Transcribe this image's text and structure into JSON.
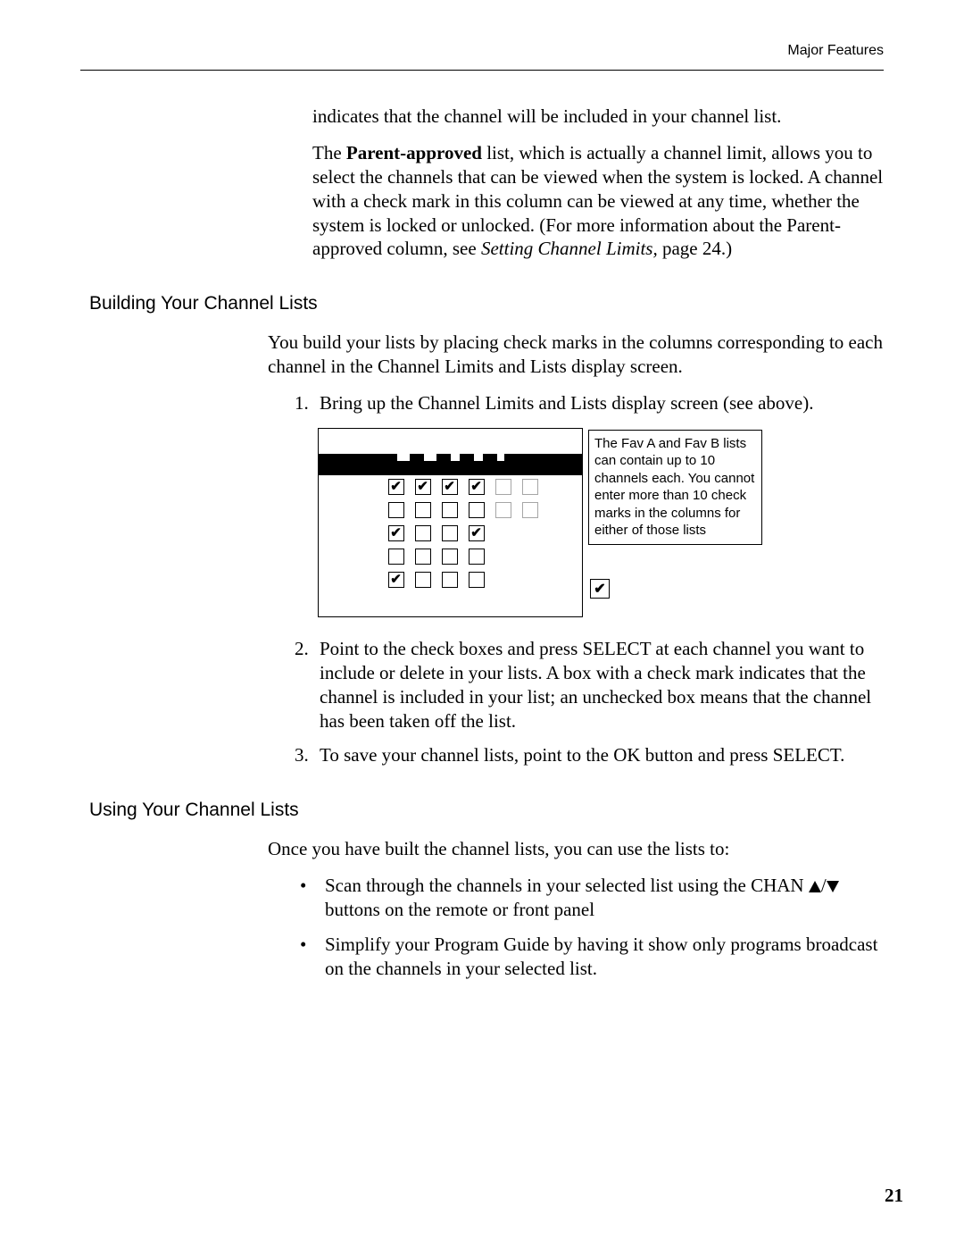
{
  "running_head": "Major Features",
  "intro_p1": "indicates that the channel will be included in your channel list.",
  "intro_p2_pre": "The ",
  "intro_p2_bold": "Parent-approved",
  "intro_p2_mid": " list, which is actually a channel limit, allows you to select the channels that can be viewed when the system is locked. A channel with a check mark in this column can be viewed at any time, whether the system is locked or unlocked. (For more information about the Parent-approved column, see ",
  "intro_p2_italic": "Setting Channel Limits,",
  "intro_p2_post": " page 24.)",
  "subhead1": "Building Your Channel Lists",
  "build_intro": "You build your lists by placing check marks in the columns corresponding to each channel in the Channel Limits and Lists display screen.",
  "ol1_num": "1.",
  "ol1_text": "Bring up the Channel Limits and Lists display screen (see above).",
  "callout_text": "The Fav A and Fav B lists can contain up to 10 channels each. You cannot enter more than 10 check marks in the columns for either of those lists",
  "ol2_num": "2.",
  "ol2_text": "Point to the check boxes and press SELECT at each channel you want to include or delete in your lists. A box with a check mark indicates that the channel is included in your list; an unchecked box means that the channel has been taken off the list.",
  "ol3_num": "3.",
  "ol3_text": "To save your channel lists, point to the OK button and press SELECT.",
  "subhead2": "Using Your Channel Lists",
  "use_intro": "Once you have built the channel lists, you can use the lists to:",
  "bullet1_pre": "Scan through the channels in your selected list using the CHAN ",
  "bullet1_sep": "/",
  "bullet1_post": " buttons on the remote or front panel",
  "bullet2": "Simplify your Program Guide by having it show only programs broadcast on the channels in your selected list.",
  "bullet_glyph": "•",
  "page_number": "21",
  "figure": {
    "rows": [
      [
        true,
        true,
        true,
        true,
        "pale",
        "pale"
      ],
      [
        false,
        false,
        false,
        false,
        "pale",
        "pale"
      ],
      [
        true,
        false,
        false,
        true,
        "sp",
        "sp"
      ],
      [
        false,
        false,
        false,
        false,
        "sp",
        "sp"
      ],
      [
        true,
        false,
        false,
        false,
        "sp",
        "sp"
      ]
    ]
  }
}
